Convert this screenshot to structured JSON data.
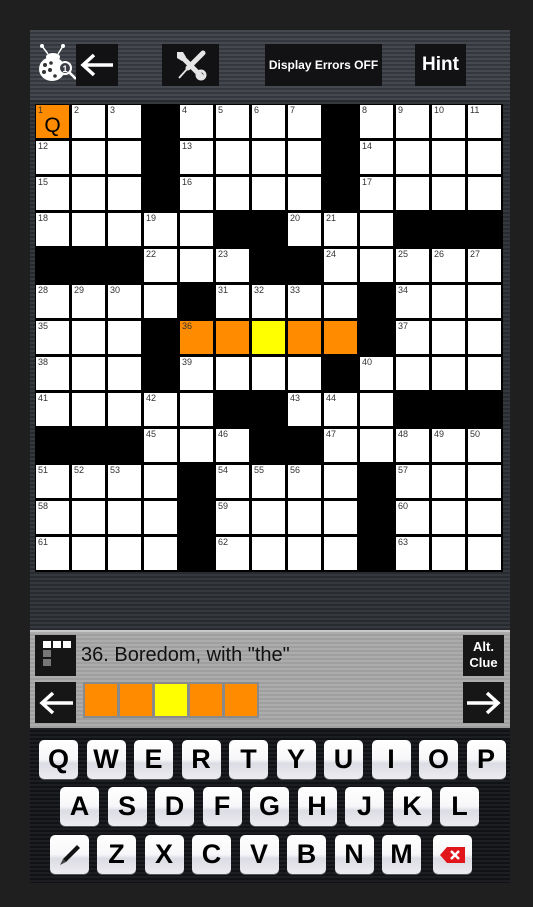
{
  "toolbar": {
    "bug_icon": "ladybug-magnifier-icon",
    "back_icon": "arrow-left-icon",
    "tools_icon": "wrench-screwdriver-icon",
    "display_errors_label": "Display Errors OFF",
    "hint_label": "Hint"
  },
  "colors": {
    "selected_word": "#ff8c00",
    "current_cell": "#ffff00",
    "black_square": "#000000",
    "white_square": "#ffffff"
  },
  "grid": {
    "size": 13,
    "rows": [
      "...#....#....",
      "...#....#....",
      "...#....#....",
      ".....##...###",
      "###...##.....",
      "....#....#...",
      "...#.....#...",
      "...#....#....",
      ".....##...###",
      "###...##.....",
      "....#....#...",
      "....#....#...",
      "....#....#..."
    ],
    "numbers": {
      "0,0": "1",
      "0,1": "2",
      "0,2": "3",
      "0,4": "4",
      "0,5": "5",
      "0,6": "6",
      "0,7": "7",
      "0,9": "8",
      "0,10": "9",
      "0,11": "10",
      "0,12": "11",
      "1,0": "12",
      "1,4": "13",
      "1,9": "14",
      "2,0": "15",
      "2,4": "16",
      "2,9": "17",
      "3,0": "18",
      "3,3": "19",
      "3,7": "20",
      "3,8": "21",
      "4,3": "22",
      "4,5": "23",
      "4,8": "24",
      "4,10": "25",
      "4,11": "26",
      "4,12": "27",
      "5,0": "28",
      "5,1": "29",
      "5,2": "30",
      "5,5": "31",
      "5,6": "32",
      "5,7": "33",
      "5,10": "34",
      "6,0": "35",
      "6,4": "36",
      "6,10": "37",
      "7,0": "38",
      "7,4": "39",
      "7,9": "40",
      "8,0": "41",
      "8,3": "42",
      "8,7": "43",
      "8,8": "44",
      "9,3": "45",
      "9,5": "46",
      "9,8": "47",
      "9,10": "48",
      "9,11": "49",
      "9,12": "50",
      "10,0": "51",
      "10,1": "52",
      "10,2": "53",
      "10,5": "54",
      "10,6": "55",
      "10,7": "56",
      "10,10": "57",
      "11,0": "58",
      "11,5": "59",
      "11,10": "60",
      "12,0": "61",
      "12,5": "62",
      "12,10": "63"
    },
    "letters": {
      "0,0": "Q"
    },
    "highlight": {
      "orange": [
        "0,0",
        "6,4",
        "6,5",
        "6,7",
        "6,8"
      ],
      "yellow": [
        "6,6"
      ]
    }
  },
  "clue": {
    "list_icon": "clue-list-icon",
    "text": "36. Boredom, with \"the\"",
    "alt_clue_line1": "Alt.",
    "alt_clue_line2": "Clue",
    "prev_icon": "arrow-left-icon",
    "next_icon": "arrow-right-icon",
    "answer_length": 5,
    "answer_current_index": 2
  },
  "keyboard": {
    "rows": [
      [
        "Q",
        "W",
        "E",
        "R",
        "T",
        "Y",
        "U",
        "I",
        "O",
        "P"
      ],
      [
        "A",
        "S",
        "D",
        "F",
        "G",
        "H",
        "J",
        "K",
        "L"
      ],
      [
        "Z",
        "X",
        "C",
        "V",
        "B",
        "N",
        "M"
      ]
    ],
    "pencil_icon": "pencil-icon",
    "delete_icon": "backspace-icon"
  }
}
